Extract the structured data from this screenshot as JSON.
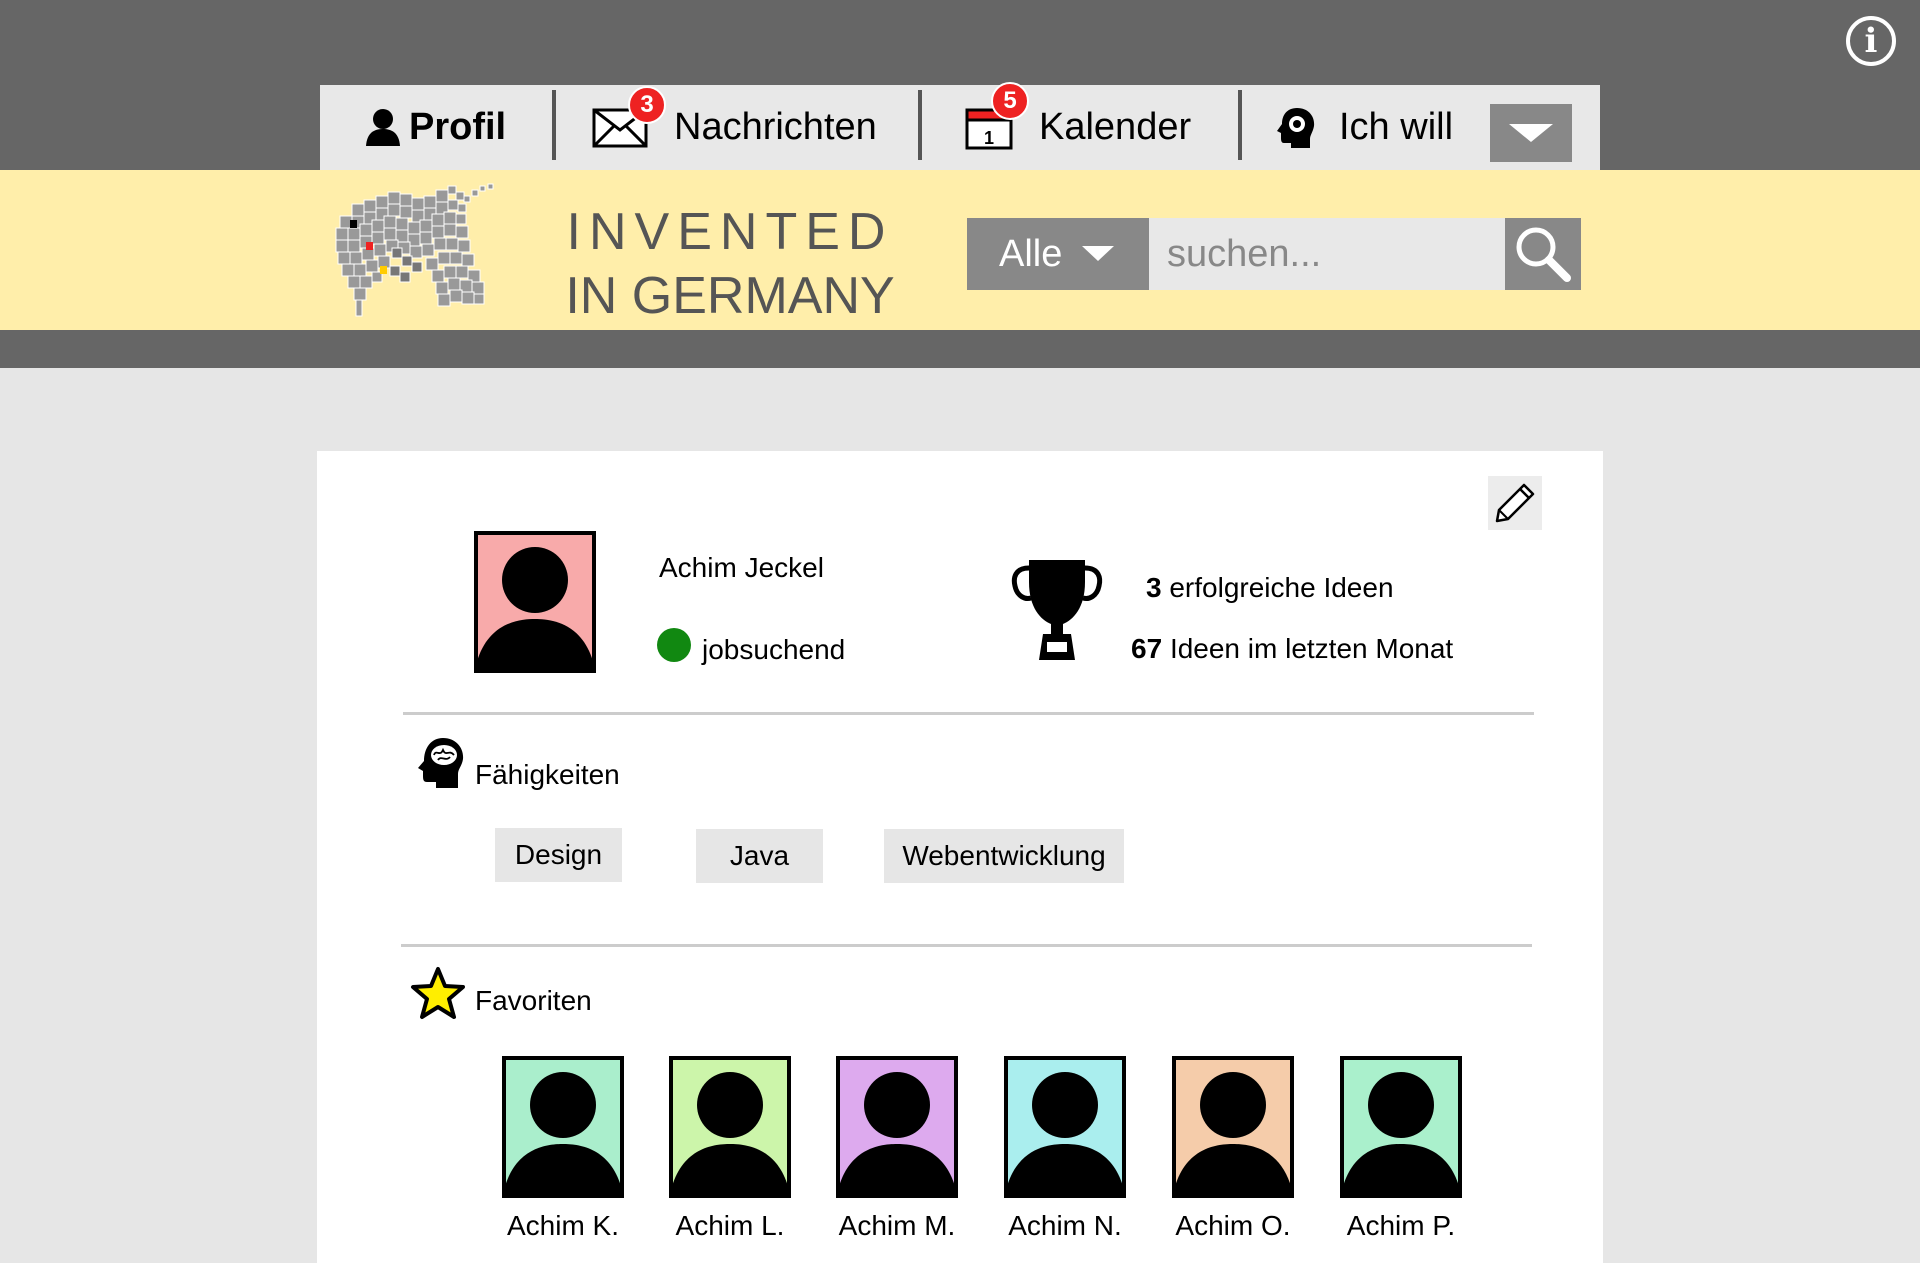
{
  "info_button": {
    "label": "i",
    "icon": "info-icon"
  },
  "nav": {
    "tabs": [
      {
        "label": "Profil",
        "icon": "user-icon"
      },
      {
        "label": "Nachrichten",
        "icon": "envelope-icon",
        "badge": "3"
      },
      {
        "label": "Kalender",
        "icon": "calendar-icon",
        "badge": "5",
        "icon_text": "1"
      },
      {
        "label": "Ich will",
        "icon": "idea-head-icon"
      }
    ],
    "dropdown_icon": "chevron-down-icon"
  },
  "brand": {
    "line1": "INVENTED",
    "line2": "IN GERMANY",
    "logo_icon": "pixel-unicorn-logo"
  },
  "search": {
    "category": "Alle",
    "placeholder": "suchen...",
    "icon": "search-icon"
  },
  "profile": {
    "name": "Achim Jeckel",
    "status": "jobsuchend",
    "status_color": "#118811",
    "avatar_color": "#f8aaaa",
    "stats": [
      {
        "value": "3",
        "label": "erfolgreiche Ideen"
      },
      {
        "value": "67",
        "label": "Ideen im letzten Monat"
      }
    ],
    "trophy_icon": "trophy-icon",
    "edit_icon": "pencil-icon"
  },
  "skills": {
    "title": "Fähigkeiten",
    "icon": "brain-head-icon",
    "items": [
      "Design",
      "Java",
      "Webentwicklung"
    ]
  },
  "favorites": {
    "title": "Favoriten",
    "icon": "star-icon",
    "star_color": "#ffee00",
    "items": [
      {
        "name": "Achim K.",
        "color": "#aaeecc"
      },
      {
        "name": "Achim L.",
        "color": "#ccf5aa"
      },
      {
        "name": "Achim M.",
        "color": "#ddaaee"
      },
      {
        "name": "Achim N.",
        "color": "#aaeeee"
      },
      {
        "name": "Achim O.",
        "color": "#f5ccaa"
      },
      {
        "name": "Achim P.",
        "color": "#aaf0cc"
      }
    ]
  }
}
